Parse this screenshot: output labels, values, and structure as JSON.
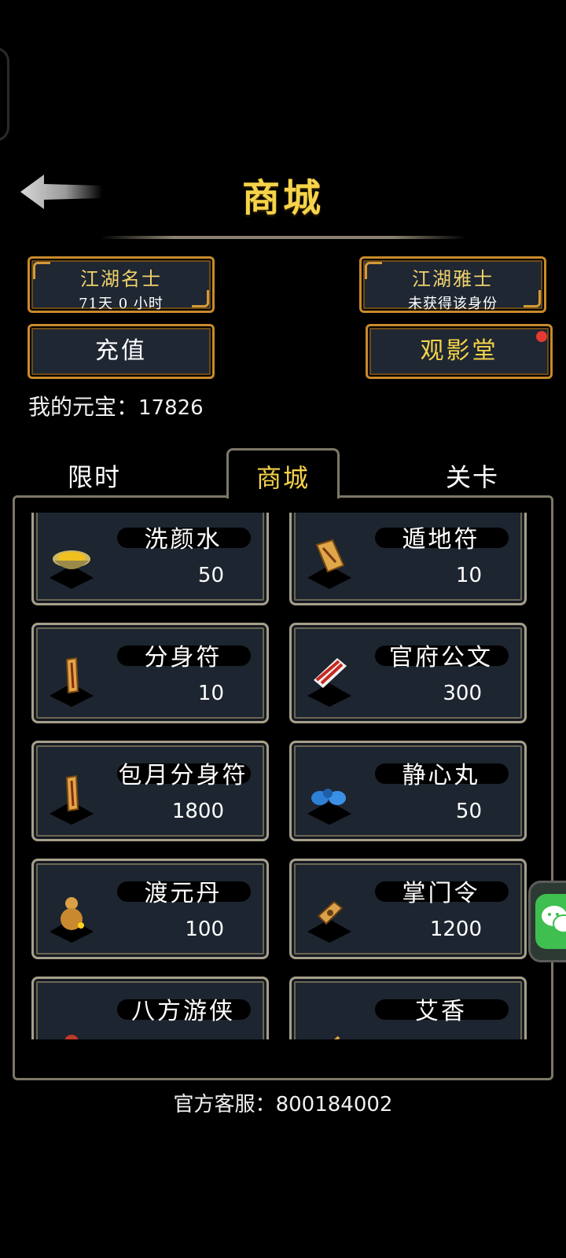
{
  "header": {
    "title": "商城"
  },
  "ranks": [
    {
      "name": "江湖名士",
      "status": "71天 0 小时"
    },
    {
      "name": "江湖雅士",
      "status": "未获得该身份"
    }
  ],
  "buttons": {
    "recharge": "充值",
    "theater": "观影堂"
  },
  "wallet": {
    "label": "我的元宝：",
    "amount": "17826"
  },
  "tabs": [
    "限时",
    "商城",
    "关卡"
  ],
  "active_tab": "商城",
  "items": [
    {
      "name": "洗颜水",
      "price": "50",
      "icon": "bowl-icon"
    },
    {
      "name": "遁地符",
      "price": "10",
      "icon": "talisman-icon"
    },
    {
      "name": "分身符",
      "price": "10",
      "icon": "talisman-icon"
    },
    {
      "name": "官府公文",
      "price": "300",
      "icon": "document-icon"
    },
    {
      "name": "包月分身符",
      "price": "1800",
      "icon": "talisman-icon"
    },
    {
      "name": "静心丸",
      "price": "50",
      "icon": "pill-icon"
    },
    {
      "name": "渡元丹",
      "price": "100",
      "icon": "gourd-icon"
    },
    {
      "name": "掌门令",
      "price": "1200",
      "icon": "token-icon"
    },
    {
      "name": "八方游侠",
      "price": "",
      "icon": "hero-icon"
    },
    {
      "name": "艾香",
      "price": "",
      "icon": "incense-icon"
    }
  ],
  "footer": {
    "service_label": "官方客服：",
    "service_number": "800184002"
  },
  "colors": {
    "gold": "#f6d34a",
    "frame": "#c98a2b",
    "card": "#1d2530",
    "badge": "#e43a32",
    "chat": "#3fbf4f"
  }
}
